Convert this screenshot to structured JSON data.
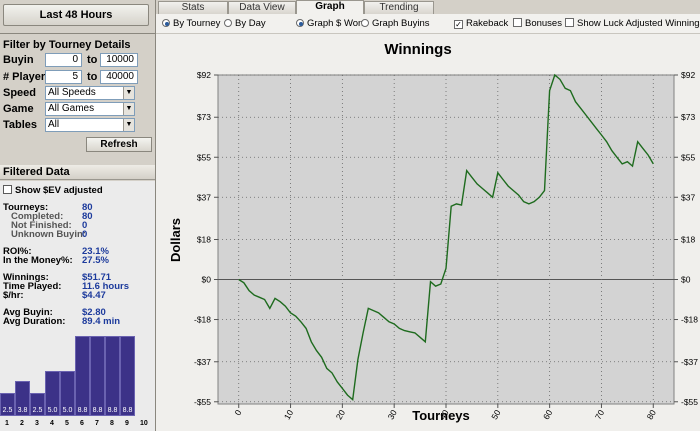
{
  "left_panel": {
    "period_button": "Last 48 Hours",
    "filter_title": "Filter by Tourney Details",
    "filters": {
      "buyin": {
        "label": "Buyin",
        "min": "0",
        "to": "to",
        "max": "10000"
      },
      "players": {
        "label": "# Players",
        "min": "5",
        "to": "to",
        "max": "40000"
      },
      "speed": {
        "label": "Speed",
        "value": "All Speeds"
      },
      "game": {
        "label": "Game",
        "value": "All Games"
      },
      "tables": {
        "label": "Tables",
        "value": "All"
      }
    },
    "refresh_label": "Refresh",
    "filtered_title": "Filtered Data",
    "show_sev_label": "Show $EV adjusted",
    "stats": {
      "tourneys": {
        "label": "Tourneys:",
        "value": "80"
      },
      "completed": {
        "label": "Completed:",
        "value": "80"
      },
      "not_finished": {
        "label": "Not Finished:",
        "value": "0"
      },
      "unknown_buyin": {
        "label": "Unknown Buyin:",
        "value": "0"
      },
      "roi": {
        "label": "ROI%:",
        "value": "23.1%"
      },
      "itm": {
        "label": "In the Money%:",
        "value": "27.5%"
      },
      "winnings": {
        "label": "Winnings:",
        "value": "$51.71"
      },
      "time_played": {
        "label": "Time Played:",
        "value": "11.6 hours"
      },
      "per_hr": {
        "label": "$/hr:",
        "value": "$4.47"
      },
      "avg_buyin": {
        "label": "Avg Buyin:",
        "value": "$2.80"
      },
      "avg_duration": {
        "label": "Avg Duration:",
        "value": "89.4 min"
      }
    },
    "histogram": {
      "bars": [
        {
          "label": "2.5",
          "value": 2.5
        },
        {
          "label": "3.8",
          "value": 3.8
        },
        {
          "label": "2.5",
          "value": 2.5
        },
        {
          "label": "5.0",
          "value": 5.0
        },
        {
          "label": "5.0",
          "value": 5.0
        },
        {
          "label": "8.8",
          "value": 8.8
        },
        {
          "label": "8.8",
          "value": 8.8
        },
        {
          "label": "8.8",
          "value": 8.8
        },
        {
          "label": "8.8",
          "value": 8.8
        }
      ],
      "ticks": [
        "1",
        "2",
        "3",
        "4",
        "5",
        "6",
        "7",
        "8",
        "9",
        "10"
      ],
      "max": 8.8,
      "color": "#3c3288"
    }
  },
  "tabs": [
    {
      "label": "Stats",
      "active": false
    },
    {
      "label": "Data View",
      "active": false
    },
    {
      "label": "Graph",
      "active": true
    },
    {
      "label": "Trending",
      "active": false
    }
  ],
  "options": {
    "by_tourney": "By Tourney",
    "by_day": "By Day",
    "graph_won": "Graph $ Won",
    "graph_buyins": "Graph Buyins",
    "rakeback": "Rakeback",
    "bonuses": "Bonuses",
    "luck_adjusted": "Show Luck Adjusted Winnings"
  },
  "chart_data": {
    "type": "line",
    "title": "Winnings",
    "xlabel": "Tourneys",
    "ylabel": "Dollars",
    "x_ticks": [
      0,
      10,
      20,
      30,
      40,
      50,
      60,
      70,
      80
    ],
    "y_ticks": [
      "-$55",
      "-$37",
      "-$18",
      "$0",
      "$18",
      "$37",
      "$55",
      "$73",
      "$92"
    ],
    "y_tick_values": [
      -55,
      -37,
      -18,
      0,
      18,
      37,
      55,
      73,
      92
    ],
    "xlim": [
      -4,
      84
    ],
    "ylim": [
      -56,
      92
    ],
    "grid": true,
    "line_color": "#1e6b1e",
    "series": [
      {
        "x": [
          0,
          1,
          2,
          3,
          4,
          5,
          6,
          7,
          8,
          9,
          10,
          11,
          12,
          13,
          14,
          15,
          16,
          17,
          18,
          19,
          20,
          21,
          22,
          23,
          24,
          25,
          26,
          27,
          28,
          29,
          30,
          31,
          32,
          33,
          34,
          35,
          36,
          37,
          38,
          39,
          40,
          41,
          42,
          43,
          44,
          45,
          46,
          47,
          48,
          49,
          50,
          51,
          52,
          53,
          54,
          55,
          56,
          57,
          58,
          59,
          60,
          61,
          62,
          63,
          64,
          65,
          66,
          67,
          68,
          69,
          70,
          71,
          72,
          73,
          74,
          75,
          76,
          77,
          78,
          79,
          80
        ],
        "y": [
          0,
          -1.5,
          -5,
          -7,
          -8,
          -9,
          -13,
          -8.5,
          -10,
          -12,
          -15,
          -16.5,
          -19,
          -22,
          -28,
          -32,
          -35,
          -40,
          -42,
          -46,
          -49,
          -52,
          -54,
          -36,
          -24,
          -13,
          -14,
          -15,
          -17,
          -19,
          -20,
          -22,
          -23,
          -23.5,
          -24,
          -26,
          -28,
          -1,
          -3,
          -2,
          5,
          33,
          34,
          33.5,
          49,
          46,
          43,
          41,
          39,
          37,
          48,
          45,
          42,
          40,
          38,
          35,
          34,
          35,
          37,
          40,
          85,
          92,
          90,
          86,
          85,
          80,
          77,
          74,
          71,
          68,
          65,
          62,
          58,
          55,
          52,
          53,
          51,
          62,
          59,
          56,
          52
        ]
      }
    ]
  }
}
